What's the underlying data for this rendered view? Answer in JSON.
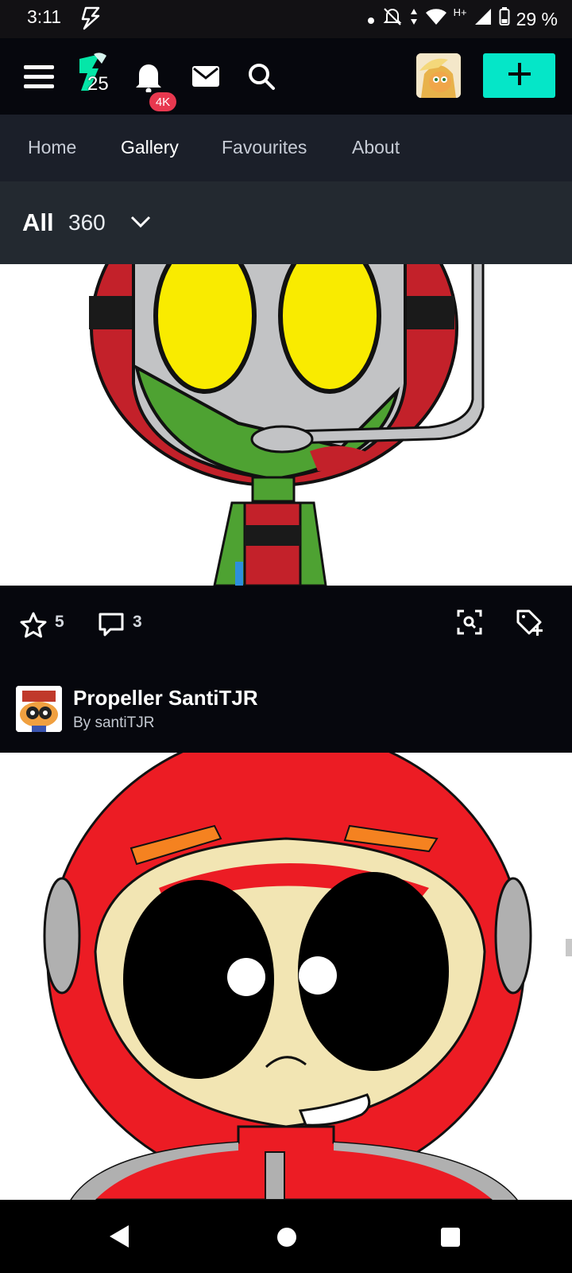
{
  "status_bar": {
    "time": "3:11",
    "network": "H+",
    "battery": "29 %"
  },
  "header": {
    "notification_badge": "4K",
    "logo_number": "25",
    "accent_color": "#05e6c8",
    "icons": [
      "menu-icon",
      "logo-icon",
      "bell-icon",
      "mail-icon",
      "search-icon",
      "plus-icon"
    ]
  },
  "tabs": [
    {
      "label": "Home"
    },
    {
      "label": "Gallery"
    },
    {
      "label": "Favourites"
    },
    {
      "label": "About"
    }
  ],
  "active_tab": "Gallery",
  "filter": {
    "label": "All",
    "count": "360"
  },
  "post1": {
    "favourites": "5",
    "comments": "3"
  },
  "post2": {
    "title": "Propeller SantiTJR",
    "byline": "By santiTJR"
  }
}
